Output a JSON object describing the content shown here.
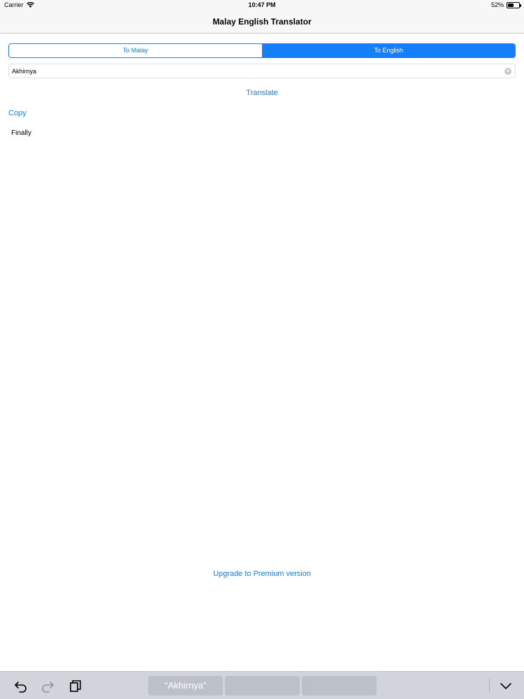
{
  "status_bar": {
    "carrier": "Carrier",
    "time": "10:47 PM",
    "battery_percent": "52%",
    "battery_level": 0.52,
    "wifi_icon": "wifi-icon",
    "battery_icon": "battery-icon"
  },
  "nav": {
    "title": "Malay English Translator"
  },
  "segments": {
    "to_malay": "To Malay",
    "to_english": "To English",
    "selected": "to_english"
  },
  "search": {
    "value": "Akhirnya",
    "clear_icon": "clear-icon"
  },
  "actions": {
    "translate": "Translate",
    "copy": "Copy",
    "upgrade": "Upgrade to Premium version"
  },
  "result": {
    "text": "Finally"
  },
  "keyboard_bar": {
    "suggestions": [
      "“Akhirnya”",
      "",
      ""
    ],
    "icons": [
      "undo-icon",
      "redo-icon",
      "paste-icon",
      "hide-keyboard-icon"
    ]
  },
  "colors": {
    "accent": "#147efb",
    "bar_background": "#f7f7f7",
    "keyboard_background": "#d1d5db"
  }
}
